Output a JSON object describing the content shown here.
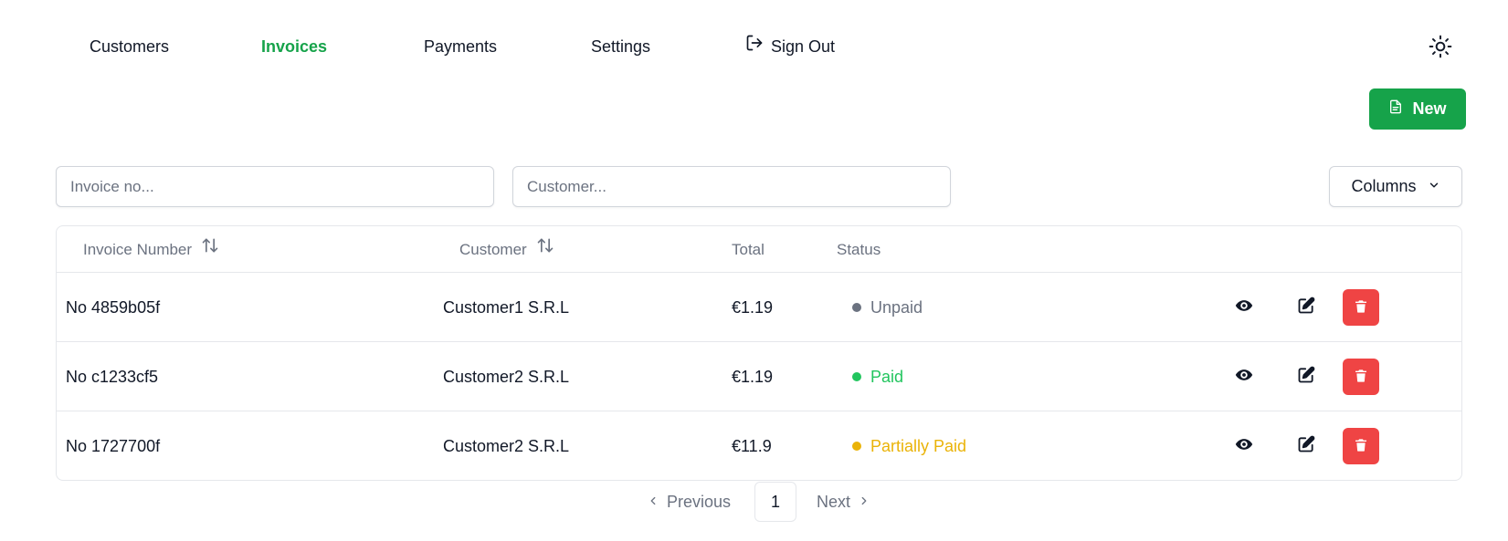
{
  "nav": {
    "items": [
      {
        "label": "Customers",
        "active": false
      },
      {
        "label": "Invoices",
        "active": true
      },
      {
        "label": "Payments",
        "active": false
      },
      {
        "label": "Settings",
        "active": false
      }
    ],
    "sign_out_label": "Sign Out",
    "sign_out_icon": "sign-out-icon",
    "theme_icon": "sun-icon"
  },
  "toolbar": {
    "new_label": "New",
    "new_icon": "document-icon",
    "new_color": "#16a34a"
  },
  "filters": {
    "invoice_placeholder": "Invoice no...",
    "invoice_value": "",
    "customer_placeholder": "Customer...",
    "customer_value": "",
    "columns_label": "Columns"
  },
  "table": {
    "headers": {
      "invoice_number": "Invoice Number",
      "customer": "Customer",
      "total": "Total",
      "status": "Status"
    },
    "rows": [
      {
        "invoice_number": "No 4859b05f",
        "customer": "Customer1 S.R.L",
        "total": "€1.19",
        "status": "Unpaid",
        "status_color": "#6b7280"
      },
      {
        "invoice_number": "No c1233cf5",
        "customer": "Customer2 S.R.L",
        "total": "€1.19",
        "status": "Paid",
        "status_color": "#22c55e"
      },
      {
        "invoice_number": "No 1727700f",
        "customer": "Customer2 S.R.L",
        "total": "€11.9",
        "status": "Partially Paid",
        "status_color": "#eab308"
      }
    ],
    "row_actions": [
      "eye-icon",
      "edit-icon",
      "trash-icon"
    ],
    "delete_color": "#ef4444"
  },
  "pagination": {
    "previous_label": "Previous",
    "next_label": "Next",
    "current_page": "1"
  }
}
